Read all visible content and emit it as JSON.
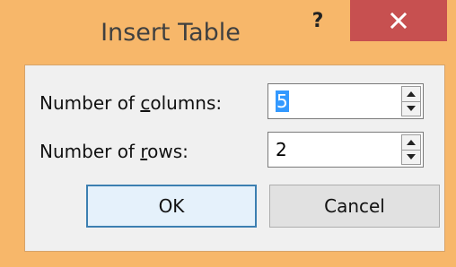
{
  "window": {
    "title": "Insert Table",
    "help_label": "?",
    "close_icon": "close-icon",
    "colors": {
      "frame": "#f7b76a",
      "close": "#c75050",
      "client": "#f0f0f0",
      "selection": "#3399ff"
    }
  },
  "form": {
    "columns": {
      "label_pre": "Number of ",
      "label_accel": "c",
      "label_post": "olumns:",
      "value": "5"
    },
    "rows": {
      "label_pre": "Number of ",
      "label_accel": "r",
      "label_post": "ows:",
      "value": "2"
    }
  },
  "buttons": {
    "ok": "OK",
    "cancel": "Cancel"
  }
}
